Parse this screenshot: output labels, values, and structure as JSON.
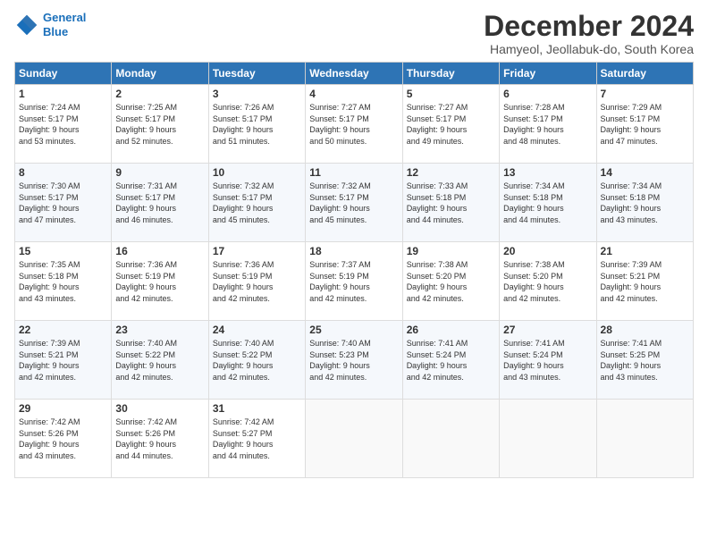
{
  "header": {
    "logo_line1": "General",
    "logo_line2": "Blue",
    "title": "December 2024",
    "subtitle": "Hamyeol, Jeollabuk-do, South Korea"
  },
  "weekdays": [
    "Sunday",
    "Monday",
    "Tuesday",
    "Wednesday",
    "Thursday",
    "Friday",
    "Saturday"
  ],
  "weeks": [
    [
      {
        "day": "1",
        "info": "Sunrise: 7:24 AM\nSunset: 5:17 PM\nDaylight: 9 hours\nand 53 minutes."
      },
      {
        "day": "2",
        "info": "Sunrise: 7:25 AM\nSunset: 5:17 PM\nDaylight: 9 hours\nand 52 minutes."
      },
      {
        "day": "3",
        "info": "Sunrise: 7:26 AM\nSunset: 5:17 PM\nDaylight: 9 hours\nand 51 minutes."
      },
      {
        "day": "4",
        "info": "Sunrise: 7:27 AM\nSunset: 5:17 PM\nDaylight: 9 hours\nand 50 minutes."
      },
      {
        "day": "5",
        "info": "Sunrise: 7:27 AM\nSunset: 5:17 PM\nDaylight: 9 hours\nand 49 minutes."
      },
      {
        "day": "6",
        "info": "Sunrise: 7:28 AM\nSunset: 5:17 PM\nDaylight: 9 hours\nand 48 minutes."
      },
      {
        "day": "7",
        "info": "Sunrise: 7:29 AM\nSunset: 5:17 PM\nDaylight: 9 hours\nand 47 minutes."
      }
    ],
    [
      {
        "day": "8",
        "info": "Sunrise: 7:30 AM\nSunset: 5:17 PM\nDaylight: 9 hours\nand 47 minutes."
      },
      {
        "day": "9",
        "info": "Sunrise: 7:31 AM\nSunset: 5:17 PM\nDaylight: 9 hours\nand 46 minutes."
      },
      {
        "day": "10",
        "info": "Sunrise: 7:32 AM\nSunset: 5:17 PM\nDaylight: 9 hours\nand 45 minutes."
      },
      {
        "day": "11",
        "info": "Sunrise: 7:32 AM\nSunset: 5:17 PM\nDaylight: 9 hours\nand 45 minutes."
      },
      {
        "day": "12",
        "info": "Sunrise: 7:33 AM\nSunset: 5:18 PM\nDaylight: 9 hours\nand 44 minutes."
      },
      {
        "day": "13",
        "info": "Sunrise: 7:34 AM\nSunset: 5:18 PM\nDaylight: 9 hours\nand 44 minutes."
      },
      {
        "day": "14",
        "info": "Sunrise: 7:34 AM\nSunset: 5:18 PM\nDaylight: 9 hours\nand 43 minutes."
      }
    ],
    [
      {
        "day": "15",
        "info": "Sunrise: 7:35 AM\nSunset: 5:18 PM\nDaylight: 9 hours\nand 43 minutes."
      },
      {
        "day": "16",
        "info": "Sunrise: 7:36 AM\nSunset: 5:19 PM\nDaylight: 9 hours\nand 42 minutes."
      },
      {
        "day": "17",
        "info": "Sunrise: 7:36 AM\nSunset: 5:19 PM\nDaylight: 9 hours\nand 42 minutes."
      },
      {
        "day": "18",
        "info": "Sunrise: 7:37 AM\nSunset: 5:19 PM\nDaylight: 9 hours\nand 42 minutes."
      },
      {
        "day": "19",
        "info": "Sunrise: 7:38 AM\nSunset: 5:20 PM\nDaylight: 9 hours\nand 42 minutes."
      },
      {
        "day": "20",
        "info": "Sunrise: 7:38 AM\nSunset: 5:20 PM\nDaylight: 9 hours\nand 42 minutes."
      },
      {
        "day": "21",
        "info": "Sunrise: 7:39 AM\nSunset: 5:21 PM\nDaylight: 9 hours\nand 42 minutes."
      }
    ],
    [
      {
        "day": "22",
        "info": "Sunrise: 7:39 AM\nSunset: 5:21 PM\nDaylight: 9 hours\nand 42 minutes."
      },
      {
        "day": "23",
        "info": "Sunrise: 7:40 AM\nSunset: 5:22 PM\nDaylight: 9 hours\nand 42 minutes."
      },
      {
        "day": "24",
        "info": "Sunrise: 7:40 AM\nSunset: 5:22 PM\nDaylight: 9 hours\nand 42 minutes."
      },
      {
        "day": "25",
        "info": "Sunrise: 7:40 AM\nSunset: 5:23 PM\nDaylight: 9 hours\nand 42 minutes."
      },
      {
        "day": "26",
        "info": "Sunrise: 7:41 AM\nSunset: 5:24 PM\nDaylight: 9 hours\nand 42 minutes."
      },
      {
        "day": "27",
        "info": "Sunrise: 7:41 AM\nSunset: 5:24 PM\nDaylight: 9 hours\nand 43 minutes."
      },
      {
        "day": "28",
        "info": "Sunrise: 7:41 AM\nSunset: 5:25 PM\nDaylight: 9 hours\nand 43 minutes."
      }
    ],
    [
      {
        "day": "29",
        "info": "Sunrise: 7:42 AM\nSunset: 5:26 PM\nDaylight: 9 hours\nand 43 minutes."
      },
      {
        "day": "30",
        "info": "Sunrise: 7:42 AM\nSunset: 5:26 PM\nDaylight: 9 hours\nand 44 minutes."
      },
      {
        "day": "31",
        "info": "Sunrise: 7:42 AM\nSunset: 5:27 PM\nDaylight: 9 hours\nand 44 minutes."
      },
      {
        "day": "",
        "info": ""
      },
      {
        "day": "",
        "info": ""
      },
      {
        "day": "",
        "info": ""
      },
      {
        "day": "",
        "info": ""
      }
    ]
  ]
}
